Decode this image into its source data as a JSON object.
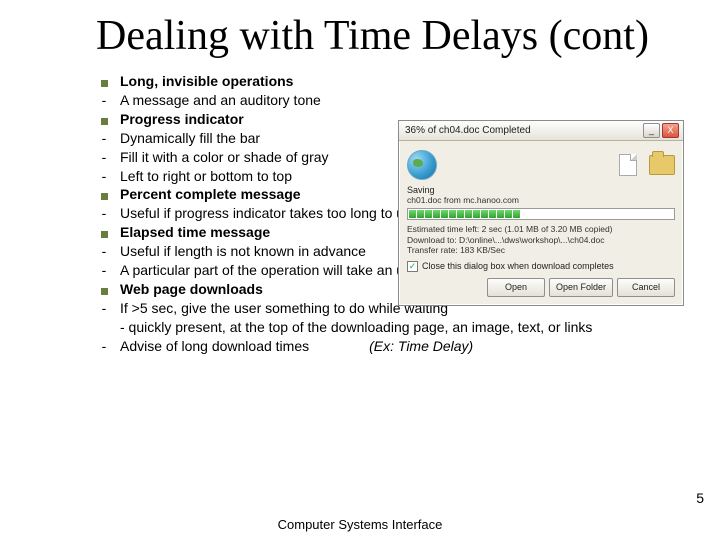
{
  "title": "Dealing with Time Delays (cont)",
  "items": [
    {
      "kind": "sq",
      "text": "Long, invisible operations",
      "bold": true
    },
    {
      "kind": "dash",
      "text": "A message and an auditory tone"
    },
    {
      "kind": "sq",
      "text": "Progress indicator",
      "bold": true
    },
    {
      "kind": "dash",
      "text": "Dynamically fill the bar"
    },
    {
      "kind": "dash",
      "text": "Fill it with a color or shade of gray"
    },
    {
      "kind": "dash",
      "text": "Left to right or bottom to top"
    },
    {
      "kind": "sq",
      "text": "Percent complete message",
      "bold": true
    },
    {
      "kind": "dash",
      "text": "Useful if progress indicator takes too long to update"
    },
    {
      "kind": "sq",
      "text": "Elapsed time message",
      "bold": true
    },
    {
      "kind": "dash",
      "text": "Useful if length is not known in advance"
    },
    {
      "kind": "dash",
      "text": "A particular part of the operation will take an unusually long time to complete"
    },
    {
      "kind": "sq",
      "text": "Web page downloads",
      "bold": true
    },
    {
      "kind": "dash",
      "text": "If >5 sec, give the user something to do while waiting"
    },
    {
      "kind": "none",
      "text": "  - quickly present, at the top of the downloading page, an image, text, or links"
    },
    {
      "kind": "dash",
      "text": "Advise of long download times",
      "annot": "(Ex: Time Delay)"
    }
  ],
  "dialog": {
    "title": "36% of ch04.doc Completed",
    "min": "_",
    "close": "X",
    "saving": "Saving",
    "url": "ch01.doc from mc.hanoo.com",
    "est": "Estimated time left: 2 sec (1.01 MB of 3.20 MB copied)",
    "dl": "Download to:     D:\\online\\...\\dws\\workshop\\...\\ch04.doc",
    "tr": "Transfer rate:    183 KB/Sec",
    "chk": "Close this dialog box when download completes",
    "open": "Open",
    "openf": "Open Folder",
    "cancel": "Cancel",
    "segments": 14
  },
  "footer": "Computer Systems Interface",
  "page": "5"
}
